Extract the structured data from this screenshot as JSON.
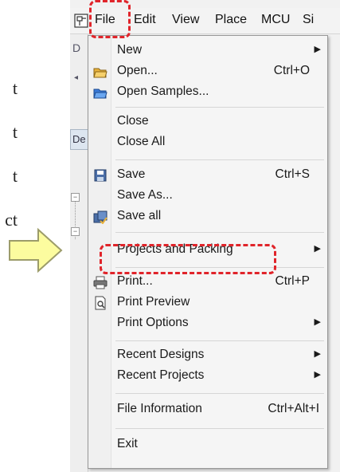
{
  "document_text": [
    "t",
    "t",
    "t",
    "ct"
  ],
  "menubar": {
    "items": [
      {
        "label": "File",
        "mnemonic_index": 0
      },
      {
        "label": "Edit",
        "mnemonic_index": 0
      },
      {
        "label": "View",
        "mnemonic_index": 0
      },
      {
        "label": "Place",
        "mnemonic_index": 0
      },
      {
        "label": "MCU",
        "mnemonic_index": 0
      },
      {
        "label": "Si",
        "mnemonic_index": 0
      }
    ]
  },
  "app": {
    "left_tab_label": "De",
    "top_control": "D"
  },
  "file_menu": {
    "items": [
      {
        "label": "New",
        "mnemonic": "N",
        "shortcut": "",
        "submenu": true,
        "icon": ""
      },
      {
        "label": "Open...",
        "mnemonic": "O",
        "shortcut": "Ctrl+O",
        "submenu": false,
        "icon": "open-folder-icon"
      },
      {
        "label": "Open Samples...",
        "mnemonic": "m",
        "shortcut": "",
        "submenu": false,
        "icon": "samples-folder-icon"
      },
      {
        "label": "Close",
        "mnemonic": "C",
        "shortcut": "",
        "submenu": false,
        "icon": ""
      },
      {
        "label": "Close All",
        "mnemonic": "l",
        "shortcut": "",
        "submenu": false,
        "icon": ""
      },
      {
        "label": "Save",
        "mnemonic": "S",
        "shortcut": "Ctrl+S",
        "submenu": false,
        "icon": "save-icon"
      },
      {
        "label": "Save As...",
        "mnemonic": "A",
        "shortcut": "",
        "submenu": false,
        "icon": ""
      },
      {
        "label": "Save all",
        "mnemonic": "v",
        "shortcut": "",
        "submenu": false,
        "icon": "save-all-icon"
      },
      {
        "label": "Projects and Packing",
        "mnemonic": "",
        "shortcut": "",
        "submenu": true,
        "icon": ""
      },
      {
        "label": "Print...",
        "mnemonic": "P",
        "shortcut": "Ctrl+P",
        "submenu": false,
        "icon": "printer-icon"
      },
      {
        "label": "Print Preview",
        "mnemonic": "v",
        "shortcut": "",
        "submenu": false,
        "icon": "print-preview-icon"
      },
      {
        "label": "Print Options",
        "mnemonic": "",
        "shortcut": "",
        "submenu": true,
        "icon": ""
      },
      {
        "label": "Recent Designs",
        "mnemonic": "g",
        "shortcut": "",
        "submenu": true,
        "icon": ""
      },
      {
        "label": "Recent Projects",
        "mnemonic": "",
        "shortcut": "",
        "submenu": true,
        "icon": ""
      },
      {
        "label": "File Information",
        "mnemonic": "I",
        "shortcut": "Ctrl+Alt+I",
        "submenu": false,
        "icon": ""
      },
      {
        "label": "Exit",
        "mnemonic": "x",
        "shortcut": "",
        "submenu": false,
        "icon": ""
      }
    ]
  },
  "colors": {
    "highlight_dash": "#e0242a",
    "arrow_fill": "#fcfc9f",
    "arrow_stroke": "#9c9c6a"
  }
}
